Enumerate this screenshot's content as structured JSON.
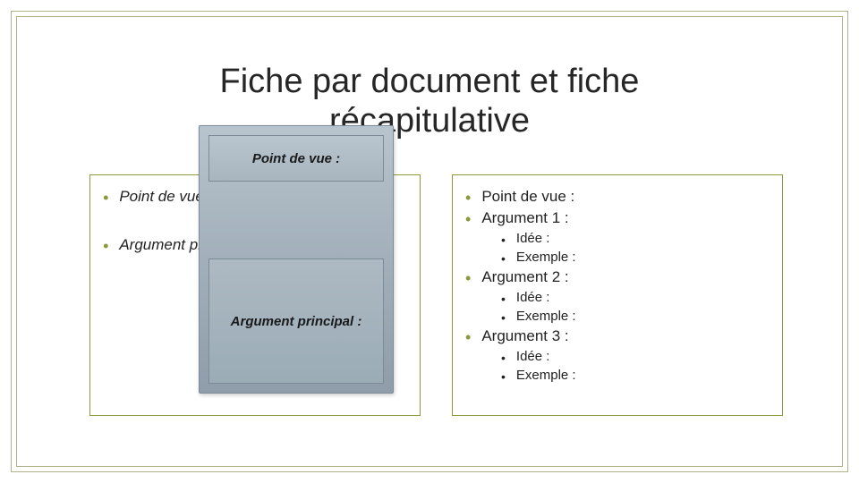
{
  "title": "Fiche par document et fiche\nrécapitulative",
  "left": {
    "item1": "Point de vue :",
    "item2": "Argument prin"
  },
  "overlay": {
    "top": "Point de vue :",
    "bottom": "Argument principal :"
  },
  "right": {
    "pov": "Point de vue :",
    "arg1": "Argument 1 :",
    "arg2": "Argument 2 :",
    "arg3": "Argument 3 :",
    "idee": "Idée :",
    "exemple": "Exemple :"
  }
}
